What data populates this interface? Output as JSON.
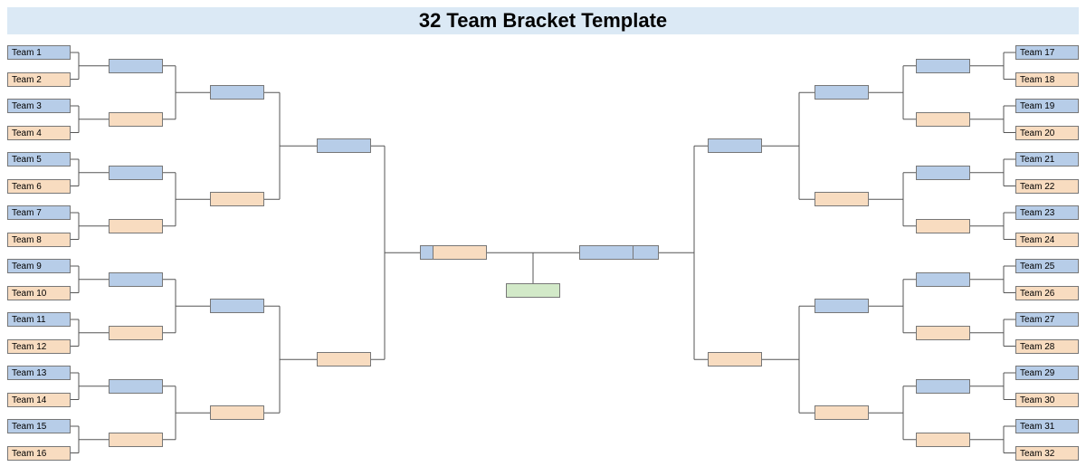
{
  "template_title": "32 Team Bracket Template",
  "left_teams": [
    "Team 1",
    "Team 2",
    "Team 3",
    "Team 4",
    "Team 5",
    "Team 6",
    "Team 7",
    "Team 8",
    "Team 9",
    "Team 10",
    "Team 11",
    "Team 12",
    "Team 13",
    "Team 14",
    "Team 15",
    "Team 16"
  ],
  "right_teams": [
    "Team 17",
    "Team 18",
    "Team 19",
    "Team 20",
    "Team 21",
    "Team 22",
    "Team 23",
    "Team 24",
    "Team 25",
    "Team 26",
    "Team 27",
    "Team 28",
    "Team 29",
    "Team 30",
    "Team 31",
    "Team 32"
  ],
  "left_r2": [
    "",
    "",
    "",
    "",
    "",
    "",
    "",
    ""
  ],
  "left_r3": [
    "",
    "",
    "",
    ""
  ],
  "left_r4": [
    "",
    ""
  ],
  "left_r5": [
    ""
  ],
  "right_r2": [
    "",
    "",
    "",
    "",
    "",
    "",
    "",
    ""
  ],
  "right_r3": [
    "",
    "",
    "",
    ""
  ],
  "right_r4": [
    "",
    ""
  ],
  "right_r5": [
    ""
  ],
  "final_left": "",
  "final_right": "",
  "champion": "",
  "colors": {
    "blue": "#b7cde8",
    "peach": "#f8dcc0",
    "green": "#d2e9c8",
    "header": "#dbe9f5"
  }
}
